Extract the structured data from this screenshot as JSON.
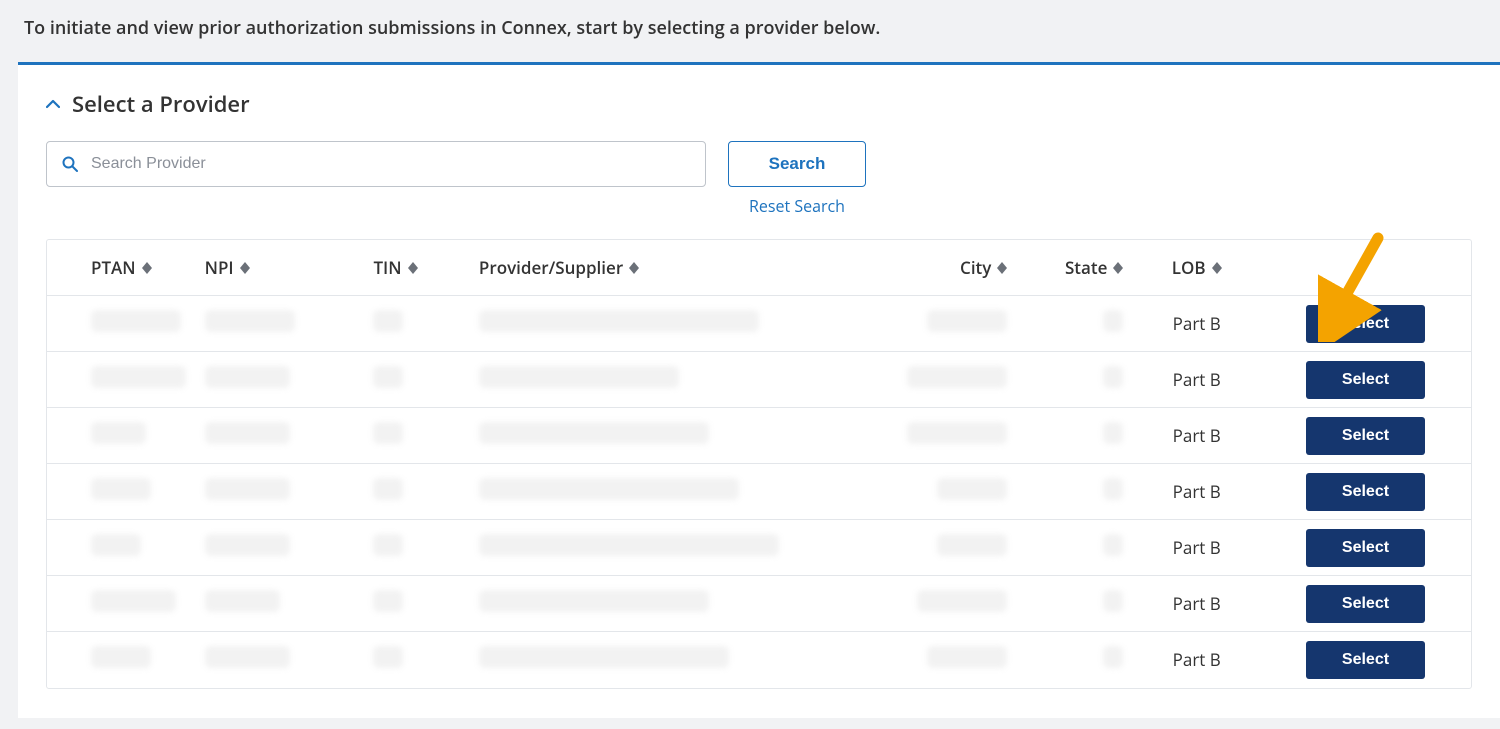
{
  "intro": "To initiate and view prior authorization submissions in Connex, start by selecting a provider below.",
  "section_title": "Select a Provider",
  "search": {
    "placeholder": "Search Provider",
    "button": "Search",
    "reset": "Reset Search"
  },
  "columns": {
    "ptan": "PTAN",
    "npi": "NPI",
    "tin": "TIN",
    "provider": "Provider/Supplier",
    "city": "City",
    "state": "State",
    "lob": "LOB"
  },
  "select_label": "Select",
  "rows": [
    {
      "lob": "Part B"
    },
    {
      "lob": "Part B"
    },
    {
      "lob": "Part B"
    },
    {
      "lob": "Part B"
    },
    {
      "lob": "Part B"
    },
    {
      "lob": "Part B"
    },
    {
      "lob": "Part B"
    }
  ],
  "blur_widths": {
    "0": {
      "ptan": 90,
      "npi": 90,
      "tin": 30,
      "prov": 280,
      "city": 80,
      "state": 20
    },
    "1": {
      "ptan": 95,
      "npi": 85,
      "tin": 30,
      "prov": 200,
      "city": 100,
      "state": 20
    },
    "2": {
      "ptan": 55,
      "npi": 85,
      "tin": 30,
      "prov": 230,
      "city": 100,
      "state": 20
    },
    "3": {
      "ptan": 60,
      "npi": 85,
      "tin": 30,
      "prov": 260,
      "city": 70,
      "state": 20
    },
    "4": {
      "ptan": 50,
      "npi": 85,
      "tin": 30,
      "prov": 300,
      "city": 70,
      "state": 20
    },
    "5": {
      "ptan": 85,
      "npi": 75,
      "tin": 30,
      "prov": 230,
      "city": 90,
      "state": 20
    },
    "6": {
      "ptan": 60,
      "npi": 85,
      "tin": 30,
      "prov": 250,
      "city": 80,
      "state": 20
    }
  }
}
